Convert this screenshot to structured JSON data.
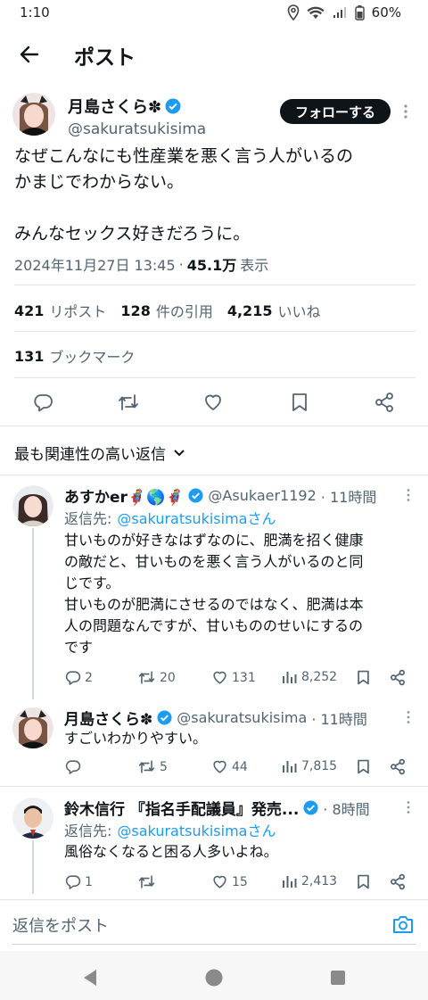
{
  "status_bar": {
    "time": "1:10",
    "battery": "60%"
  },
  "header": {
    "title": "ポスト"
  },
  "main_post": {
    "author_name": "月島さくら✽",
    "handle": "@sakuratsukisima",
    "follow_label": "フォローする",
    "text_lines": [
      "なぜこんなにも性産業を悪く言う人がいるの",
      "かまじでわからない。",
      "",
      "みんなセックス好きだろうに。"
    ],
    "timestamp": "2024年11月27日 13:45",
    "views_count": "45.1万",
    "views_label": "表示",
    "reposts_count": "421",
    "reposts_label": "リポスト",
    "quotes_count": "128",
    "quotes_label": "件の引用",
    "likes_count": "4,215",
    "likes_label": "いいね",
    "bookmarks_count": "131",
    "bookmarks_label": "ブックマーク"
  },
  "sort": {
    "label": "最も関連性の高い返信"
  },
  "replies": [
    {
      "name": "あすかer🦸🌎🦸",
      "handle": "@Asukaer1192",
      "time": "· 11時間",
      "reply_to_label": "返信先:",
      "reply_to_handle": "@sakuratsukisimaさん",
      "text_lines": [
        "甘いものが好きなはずなのに、肥満を招く健康",
        "の敵だと、甘いものを悪く言う人がいるのと同",
        "じです。",
        "甘いものが肥満にさせるのではなく、肥満は本",
        "人の問題なんですが、甘いもののせいにするの",
        "です"
      ],
      "replies_count": "2",
      "reposts_count": "20",
      "likes_count": "131",
      "views_count": "8,252"
    },
    {
      "name": "月島さくら✽",
      "handle": "@sakuratsukisima",
      "time": "· 11時間",
      "text_lines": [
        "すごいわかりやすい。"
      ],
      "replies_count": "",
      "reposts_count": "5",
      "likes_count": "44",
      "views_count": "7,815"
    },
    {
      "name": "鈴木信行 『指名手配議員』発売...",
      "handle": "",
      "time": "· 8時間",
      "reply_to_label": "返信先:",
      "reply_to_handle": "@sakuratsukisimaさん",
      "text_lines": [
        "風俗なくなると困る人多いよね。"
      ],
      "replies_count": "1",
      "reposts_count": "",
      "likes_count": "15",
      "views_count": "2,413"
    }
  ],
  "composer": {
    "placeholder": "返信をポスト"
  },
  "colors": {
    "accent": "#1d9bf0",
    "verified": "#1d9bf0",
    "text": "#0f1419",
    "muted": "#536471"
  }
}
